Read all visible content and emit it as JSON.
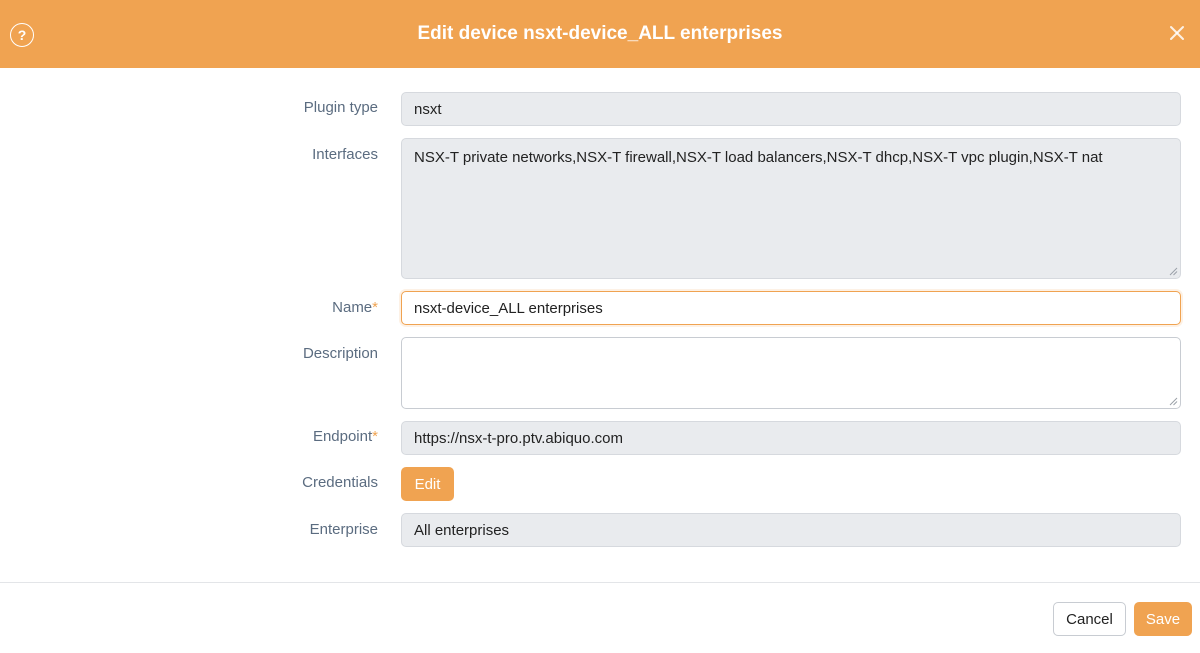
{
  "dialog": {
    "title": "Edit device nsxt-device_ALL enterprises",
    "help_glyph": "?",
    "colors": {
      "accent": "#f0a351",
      "label": "#5b6c80",
      "readonly_bg": "#e9ebee"
    }
  },
  "form": {
    "plugin_type": {
      "label": "Plugin type",
      "value": "nsxt"
    },
    "interfaces": {
      "label": "Interfaces",
      "value": "NSX-T private networks,NSX-T firewall,NSX-T load balancers,NSX-T dhcp,NSX-T vpc plugin,NSX-T nat"
    },
    "name": {
      "label": "Name",
      "required_mark": "*",
      "value": "nsxt-device_ALL enterprises"
    },
    "description": {
      "label": "Description",
      "value": ""
    },
    "endpoint": {
      "label": "Endpoint",
      "required_mark": "*",
      "value": "https://nsx-t-pro.ptv.abiquo.com"
    },
    "credentials": {
      "label": "Credentials",
      "button_label": "Edit"
    },
    "enterprise": {
      "label": "Enterprise",
      "value": "All enterprises"
    }
  },
  "footer": {
    "cancel_label": "Cancel",
    "save_label": "Save"
  },
  "icons": {
    "help": "help-circle-icon",
    "close": "close-icon",
    "resize": "resize-grip-icon"
  }
}
